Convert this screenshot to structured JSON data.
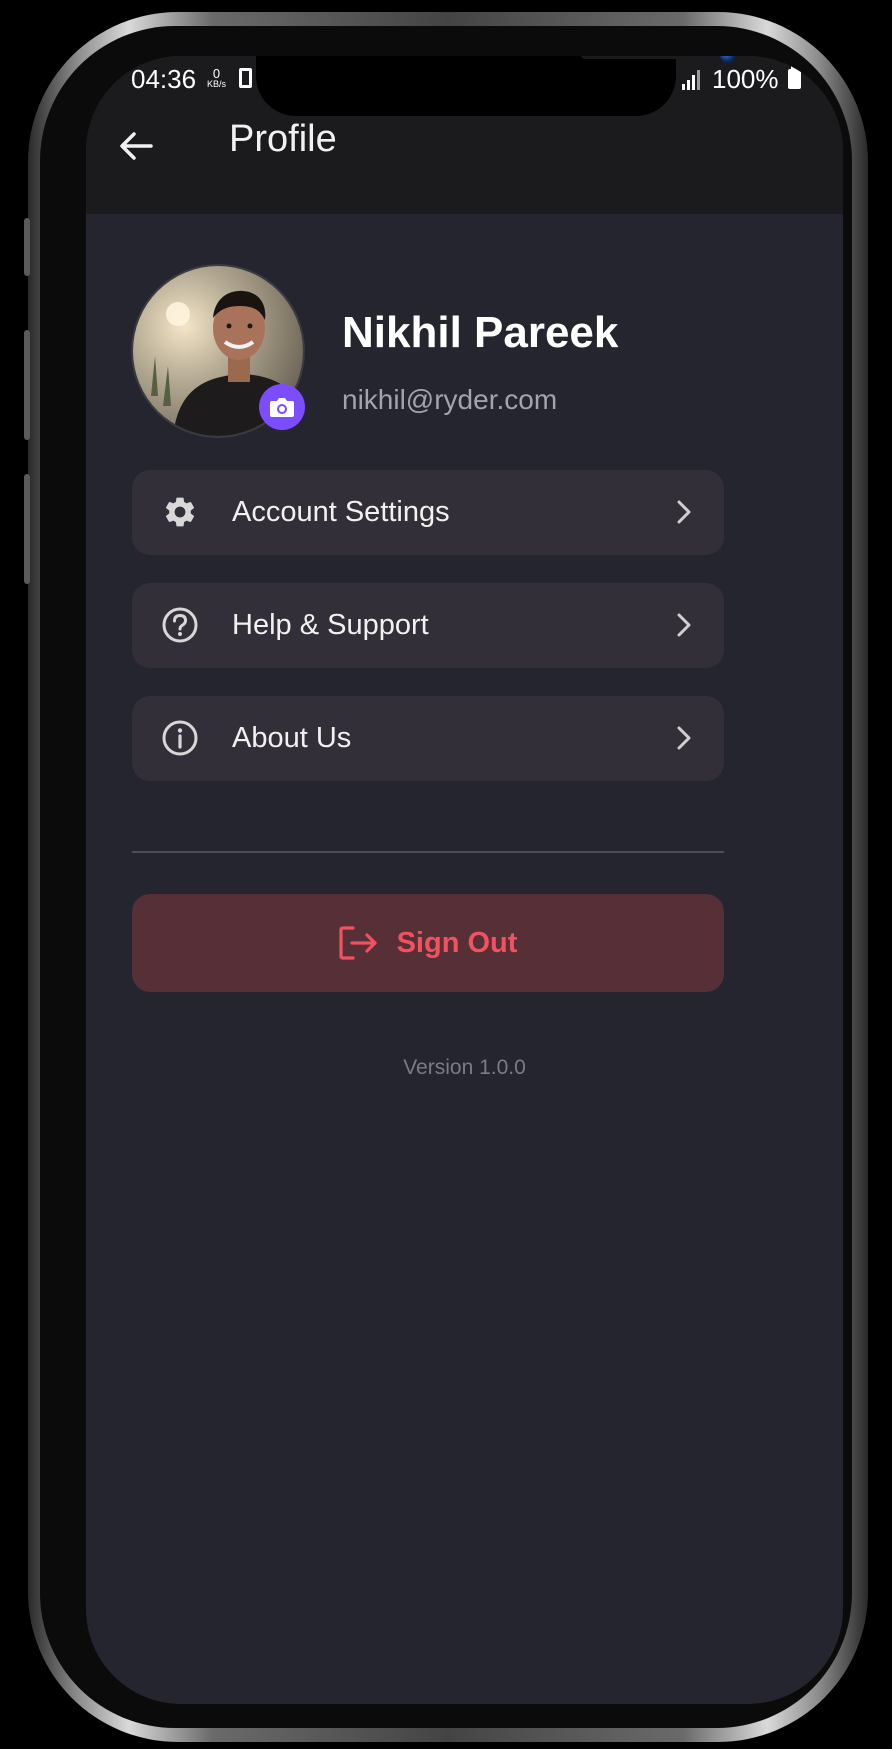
{
  "status_bar": {
    "time": "04:36",
    "network_speed_value": "0",
    "network_speed_unit": "KB/s",
    "battery": "100%"
  },
  "app_bar": {
    "title": "Profile"
  },
  "profile": {
    "name": "Nikhil Pareek",
    "email": "nikhil@ryder.com"
  },
  "menu": {
    "items": [
      {
        "label": "Account Settings",
        "icon": "gear-icon"
      },
      {
        "label": "Help & Support",
        "icon": "question-circle-icon"
      },
      {
        "label": "About Us",
        "icon": "info-circle-icon"
      }
    ]
  },
  "sign_out": {
    "label": "Sign Out",
    "icon": "logout-icon",
    "color": "#f0525f"
  },
  "footer": {
    "version": "Version 1.0.0"
  },
  "theme": {
    "background": "#24252f",
    "card": "#332f38",
    "accent": "#7c4dff",
    "danger_bg": "#562f37"
  }
}
